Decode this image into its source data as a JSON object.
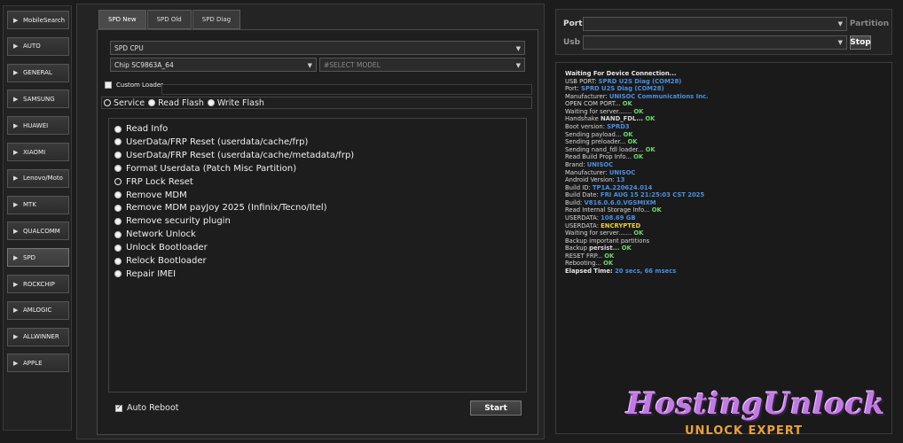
{
  "sidebar": {
    "items": [
      {
        "label": "MobileSearch",
        "icon": "search-icon"
      },
      {
        "label": "AUTO",
        "icon": "arrow-icon"
      },
      {
        "label": "GENERAL",
        "icon": "arrow-icon"
      },
      {
        "label": "SAMSUNG",
        "icon": "arrow-icon"
      },
      {
        "label": "HUAWEI",
        "icon": "arrow-icon"
      },
      {
        "label": "XIAOMI",
        "icon": "arrow-icon"
      },
      {
        "label": "Lenovo/Moto",
        "icon": "arrow-icon"
      },
      {
        "label": "MTK",
        "icon": "arrow-icon"
      },
      {
        "label": "QUALCOMM",
        "icon": "arrow-icon"
      },
      {
        "label": "SPD",
        "icon": "arrow-icon"
      },
      {
        "label": "ROCKCHIP",
        "icon": "arrow-icon"
      },
      {
        "label": "AMLOGIC",
        "icon": "arrow-icon"
      },
      {
        "label": "ALLWINNER",
        "icon": "arrow-icon"
      },
      {
        "label": "APPLE",
        "icon": "arrow-icon"
      }
    ],
    "active_index": 9
  },
  "tabs": [
    {
      "label": "SPD New"
    },
    {
      "label": "SPD Old"
    },
    {
      "label": "SPD Diag"
    }
  ],
  "selects": {
    "cpu": "SPD CPU",
    "chip": "Chip SC9863A_64",
    "model": "#SELECT MODEL"
  },
  "custom_loader": {
    "label": "Custom Loader"
  },
  "modes": [
    {
      "label": "Service"
    },
    {
      "label": "Read  Flash"
    },
    {
      "label": "Write Flash"
    }
  ],
  "operations": [
    {
      "label": "Read Info"
    },
    {
      "label": "UserData/FRP Reset (userdata/cache/frp)"
    },
    {
      "label": "UserData/FRP Reset (userdata/cache/metadata/frp)"
    },
    {
      "label": "Format Userdata (Patch Misc Partition)"
    },
    {
      "label": "FRP Lock Reset"
    },
    {
      "label": "Remove MDM"
    },
    {
      "label": "Remove MDM payJoy 2025 (Infinix/Tecno/Itel)"
    },
    {
      "label": "Remove security plugin"
    },
    {
      "label": "Network Unlock"
    },
    {
      "label": "Unlock Bootloader"
    },
    {
      "label": "Relock Bootloader"
    },
    {
      "label": "Repair IMEI"
    }
  ],
  "auto_reboot": {
    "label": "Auto Reboot",
    "checked": true
  },
  "start_label": "Start",
  "port": {
    "label": "Port",
    "button": "Partition"
  },
  "usb": {
    "label": "Usb",
    "button": "Stop"
  },
  "log": [
    {
      "t": "Waiting For Device Connection...",
      "b": true
    },
    {
      "t": "USB PORT: ",
      "v": "SPRD U2S Diag (COM28)"
    },
    {
      "t": "Port: ",
      "v": "SPRD U2S Diag (COM28)"
    },
    {
      "t": "Manufacturer: ",
      "v": "UNISOC Communications Inc."
    },
    {
      "t": "OPEN COM PORT... ",
      "ok": "OK"
    },
    {
      "t": "Waiting for server....... ",
      "ok": "OK"
    },
    {
      "t": "Handshake ",
      "bold": "NAND_FDL...",
      "ok": " OK"
    },
    {
      "t": "Boot version: ",
      "v": "SPRD3"
    },
    {
      "t": "Sending payload... ",
      "ok": "OK"
    },
    {
      "t": "Sending preloader... ",
      "ok": "OK"
    },
    {
      "t": "Sending nand_fdl loader... ",
      "ok": "OK"
    },
    {
      "t": "Read Build Prop Info... ",
      "ok": "OK"
    },
    {
      "t": "  Brand: ",
      "v": "UNISOC"
    },
    {
      "t": "  Manufacturer: ",
      "v": "UNISOC"
    },
    {
      "t": "  Android Version: ",
      "v": "13"
    },
    {
      "t": "  Build ID: ",
      "v": "TP1A.220624.014"
    },
    {
      "t": "  Build Date: ",
      "v": "FRI AUG 15 21:25:03 CST 2025"
    },
    {
      "t": "  Build: ",
      "v": "V816.0.6.0.VGSMIXM"
    },
    {
      "t": "Read Internal Storage Info... ",
      "ok": "OK"
    },
    {
      "t": "USERDATA: ",
      "v": "108.69 GB"
    },
    {
      "t": "USERDATA: ",
      "warn": "ENCRYPTED"
    },
    {
      "t": "Waiting for server....... ",
      "ok": "OK"
    },
    {
      "t": "Backup important partitions"
    },
    {
      "t": "  Backup ",
      "bold": "persist",
      "ok": "... OK"
    },
    {
      "t": "RESET FRP... ",
      "ok": "OK"
    },
    {
      "t": "Rebooting... ",
      "ok": "OK"
    },
    {
      "t": "Elapsed Time: ",
      "v": "20 secs, 66 msecs",
      "b": true
    }
  ],
  "watermark": {
    "main": "HostingUnlock",
    "sub": "UNLOCK EXPERT"
  }
}
